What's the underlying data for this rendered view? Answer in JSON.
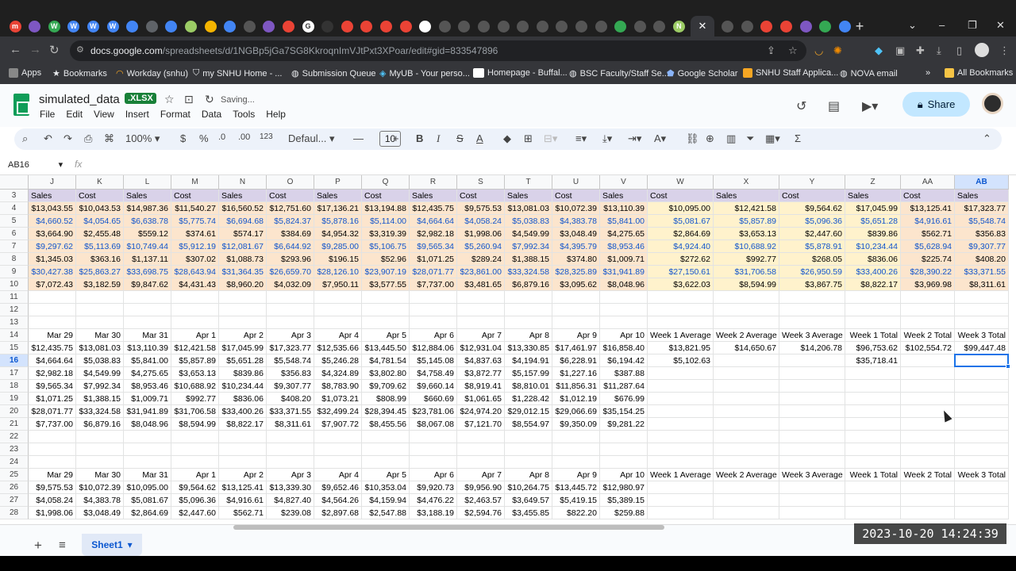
{
  "browser": {
    "url_host": "docs.google.com",
    "url_path": "/spreadsheets/d/1NGBp5jGa7SG8KkroqnImVJtPxt3XPoar/edit#gid=833547896",
    "bookmarks": [
      "Apps",
      "Bookmarks",
      "Workday (snhu)",
      "my SNHU Home - ...",
      "Submission Queue",
      "MyUB - Your perso...",
      "Homepage - Buffal...",
      "BSC Faculty/Staff Se...",
      "Google Scholar",
      "SNHU Staff Applica...",
      "NOVA email",
      "All Bookmarks"
    ],
    "tab_letters": [
      "m",
      "",
      "W",
      "W",
      "W",
      "W",
      "",
      "",
      "",
      "",
      "",
      "",
      "",
      "",
      "",
      "G",
      "",
      "",
      "",
      "",
      "",
      "",
      "",
      "",
      "",
      "",
      "",
      "",
      "",
      "",
      "",
      "",
      "",
      "",
      "N",
      "N",
      "",
      "",
      ""
    ]
  },
  "app": {
    "title": "simulated_data",
    "badge": ".XLSX",
    "status": "Saving...",
    "menu": [
      "File",
      "Edit",
      "View",
      "Insert",
      "Format",
      "Data",
      "Tools",
      "Help"
    ],
    "share_label": "Share"
  },
  "toolbar": {
    "zoom": "100%",
    "currency": "$",
    "percent": "%",
    "dec_decrease": ".0",
    "dec_increase": ".00",
    "number_format": "123",
    "font": "Defaul...",
    "font_size": "10",
    "bold": "B",
    "italic": "I",
    "strike": "S",
    "text_color": "A"
  },
  "formula_bar": {
    "name_box": "AB16",
    "fx": "fx"
  },
  "grid": {
    "columns": [
      "J",
      "K",
      "L",
      "M",
      "N",
      "O",
      "P",
      "Q",
      "R",
      "S",
      "T",
      "U",
      "V",
      "W",
      "X",
      "Y",
      "Z",
      "AA",
      "AB"
    ],
    "selected_column": "AB",
    "selected_row": "16",
    "rows": [
      {
        "n": "3",
        "cells": [
          "Sales",
          "Cost",
          "Sales",
          "Cost",
          "Sales",
          "Cost",
          "Sales",
          "Cost",
          "Sales",
          "Cost",
          "Sales",
          "Cost",
          "Sales",
          "Cost",
          "Sales",
          "Cost",
          "Sales",
          "Cost",
          "Sales"
        ]
      },
      {
        "n": "4",
        "cells": [
          "$13,043.55",
          "$10,043.53",
          "$14,987.36",
          "$11,540.27",
          "$16,560.52",
          "$12,751.60",
          "$17,136.21",
          "$13,194.88",
          "$12,435.75",
          "$9,575.53",
          "$13,081.03",
          "$10,072.39",
          "$13,110.39",
          "$10,095.00",
          "$12,421.58",
          "$9,564.62",
          "$17,045.99",
          "$13,125.41",
          "$17,323.77"
        ]
      },
      {
        "n": "5",
        "cells": [
          "$4,660.52",
          "$4,054.65",
          "$6,638.78",
          "$5,775.74",
          "$6,694.68",
          "$5,824.37",
          "$5,878.16",
          "$5,114.00",
          "$4,664.64",
          "$4,058.24",
          "$5,038.83",
          "$4,383.78",
          "$5,841.00",
          "$5,081.67",
          "$5,857.89",
          "$5,096.36",
          "$5,651.28",
          "$4,916.61",
          "$5,548.74"
        ]
      },
      {
        "n": "6",
        "cells": [
          "$3,664.90",
          "$2,455.48",
          "$559.12",
          "$374.61",
          "$574.17",
          "$384.69",
          "$4,954.32",
          "$3,319.39",
          "$2,982.18",
          "$1,998.06",
          "$4,549.99",
          "$3,048.49",
          "$4,275.65",
          "$2,864.69",
          "$3,653.13",
          "$2,447.60",
          "$839.86",
          "$562.71",
          "$356.83"
        ]
      },
      {
        "n": "7",
        "cells": [
          "$9,297.62",
          "$5,113.69",
          "$10,749.44",
          "$5,912.19",
          "$12,081.67",
          "$6,644.92",
          "$9,285.00",
          "$5,106.75",
          "$9,565.34",
          "$5,260.94",
          "$7,992.34",
          "$4,395.79",
          "$8,953.46",
          "$4,924.40",
          "$10,688.92",
          "$5,878.91",
          "$10,234.44",
          "$5,628.94",
          "$9,307.77"
        ]
      },
      {
        "n": "8",
        "cells": [
          "$1,345.03",
          "$363.16",
          "$1,137.11",
          "$307.02",
          "$1,088.73",
          "$293.96",
          "$196.15",
          "$52.96",
          "$1,071.25",
          "$289.24",
          "$1,388.15",
          "$374.80",
          "$1,009.71",
          "$272.62",
          "$992.77",
          "$268.05",
          "$836.06",
          "$225.74",
          "$408.20"
        ]
      },
      {
        "n": "9",
        "cells": [
          "$30,427.38",
          "$25,863.27",
          "$33,698.75",
          "$28,643.94",
          "$31,364.35",
          "$26,659.70",
          "$28,126.10",
          "$23,907.19",
          "$28,071.77",
          "$23,861.00",
          "$33,324.58",
          "$28,325.89",
          "$31,941.89",
          "$27,150.61",
          "$31,706.58",
          "$26,950.59",
          "$33,400.26",
          "$28,390.22",
          "$33,371.55"
        ]
      },
      {
        "n": "10",
        "cells": [
          "$7,072.43",
          "$3,182.59",
          "$9,847.62",
          "$4,431.43",
          "$8,960.20",
          "$4,032.09",
          "$7,950.11",
          "$3,577.55",
          "$7,737.00",
          "$3,481.65",
          "$6,879.16",
          "$3,095.62",
          "$8,048.96",
          "$3,622.03",
          "$8,594.99",
          "$3,867.75",
          "$8,822.17",
          "$3,969.98",
          "$8,311.61"
        ]
      },
      {
        "n": "11",
        "cells": []
      },
      {
        "n": "12",
        "cells": []
      },
      {
        "n": "13",
        "cells": []
      },
      {
        "n": "14",
        "cells": [
          "Mar 29",
          "Mar 30",
          "Mar 31",
          "Apr 1",
          "Apr 2",
          "Apr 3",
          "Apr 4",
          "Apr 5",
          "Apr 6",
          "Apr 7",
          "Apr 8",
          "Apr 9",
          "Apr 10",
          "Week 1 Average",
          "Week 2 Average",
          "Week 3 Average",
          "Week 1 Total",
          "Week 2 Total",
          "Week 3 Total"
        ]
      },
      {
        "n": "15",
        "cells": [
          "$12,435.75",
          "$13,081.03",
          "$13,110.39",
          "$12,421.58",
          "$17,045.99",
          "$17,323.77",
          "$12,535.66",
          "$13,445.50",
          "$12,884.06",
          "$12,931.04",
          "$13,330.85",
          "$17,461.97",
          "$16,858.40",
          "$13,821.95",
          "$14,650.67",
          "$14,206.78",
          "$96,753.62",
          "$102,554.72",
          "$99,447.48"
        ]
      },
      {
        "n": "16",
        "cells": [
          "$4,664.64",
          "$5,038.83",
          "$5,841.00",
          "$5,857.89",
          "$5,651.28",
          "$5,548.74",
          "$5,246.28",
          "$4,781.54",
          "$5,145.08",
          "$4,837.63",
          "$4,194.91",
          "$6,228.91",
          "$6,194.42",
          "$5,102.63",
          "",
          "",
          "$35,718.41",
          "",
          ""
        ]
      },
      {
        "n": "17",
        "cells": [
          "$2,982.18",
          "$4,549.99",
          "$4,275.65",
          "$3,653.13",
          "$839.86",
          "$356.83",
          "$4,324.89",
          "$3,802.80",
          "$4,758.49",
          "$3,872.77",
          "$5,157.99",
          "$1,227.16",
          "$387.88"
        ]
      },
      {
        "n": "18",
        "cells": [
          "$9,565.34",
          "$7,992.34",
          "$8,953.46",
          "$10,688.92",
          "$10,234.44",
          "$9,307.77",
          "$8,783.90",
          "$9,709.62",
          "$9,660.14",
          "$8,919.41",
          "$8,810.01",
          "$11,856.31",
          "$11,287.64"
        ]
      },
      {
        "n": "19",
        "cells": [
          "$1,071.25",
          "$1,388.15",
          "$1,009.71",
          "$992.77",
          "$836.06",
          "$408.20",
          "$1,073.21",
          "$808.99",
          "$660.69",
          "$1,061.65",
          "$1,228.42",
          "$1,012.19",
          "$676.99"
        ]
      },
      {
        "n": "20",
        "cells": [
          "$28,071.77",
          "$33,324.58",
          "$31,941.89",
          "$31,706.58",
          "$33,400.26",
          "$33,371.55",
          "$32,499.24",
          "$28,394.45",
          "$23,781.06",
          "$24,974.20",
          "$29,012.15",
          "$29,066.69",
          "$35,154.25"
        ]
      },
      {
        "n": "21",
        "cells": [
          "$7,737.00",
          "$6,879.16",
          "$8,048.96",
          "$8,594.99",
          "$8,822.17",
          "$8,311.61",
          "$7,907.72",
          "$8,455.56",
          "$8,067.08",
          "$7,121.70",
          "$8,554.97",
          "$9,350.09",
          "$9,281.22"
        ]
      },
      {
        "n": "22",
        "cells": []
      },
      {
        "n": "23",
        "cells": []
      },
      {
        "n": "24",
        "cells": []
      },
      {
        "n": "25",
        "cells": [
          "Mar 29",
          "Mar 30",
          "Mar 31",
          "Apr 1",
          "Apr 2",
          "Apr 3",
          "Apr 4",
          "Apr 5",
          "Apr 6",
          "Apr 7",
          "Apr 8",
          "Apr 9",
          "Apr 10",
          "Week 1 Average",
          "Week 2 Average",
          "Week 3 Average",
          "Week 1 Total",
          "Week 2 Total",
          "Week 3 Total"
        ]
      },
      {
        "n": "26",
        "cells": [
          "$9,575.53",
          "$10,072.39",
          "$10,095.00",
          "$9,564.62",
          "$13,125.41",
          "$13,339.30",
          "$9,652.46",
          "$10,353.04",
          "$9,920.73",
          "$9,956.90",
          "$10,264.75",
          "$13,445.72",
          "$12,980.97"
        ]
      },
      {
        "n": "27",
        "cells": [
          "$4,058.24",
          "$4,383.78",
          "$5,081.67",
          "$5,096.36",
          "$4,916.61",
          "$4,827.40",
          "$4,564.26",
          "$4,159.94",
          "$4,476.22",
          "$2,463.57",
          "$3,649.57",
          "$5,419.15",
          "$5,389.15"
        ]
      },
      {
        "n": "28",
        "cells": [
          "$1,998.06",
          "$3,048.49",
          "$2,864.69",
          "$2,447.60",
          "$562.71",
          "$239.08",
          "$2,897.68",
          "$2,547.88",
          "$3,188.19",
          "$2,594.76",
          "$3,455.85",
          "$822.20",
          "$259.88"
        ]
      }
    ]
  },
  "sheets": {
    "active": "Sheet1"
  },
  "overlay": {
    "timestamp": "2023-10-20 14:24:39"
  },
  "colors": {
    "header_row": "#d9d2e9",
    "data_orange": "#fce5cd",
    "data_yellow": "#fff2cc",
    "blue_text": "#1155cc",
    "selection": "#1a73e8"
  }
}
